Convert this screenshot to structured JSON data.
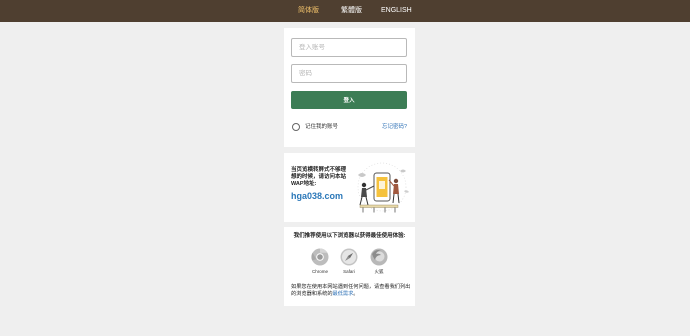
{
  "header": {
    "languages": [
      {
        "label": "简体版",
        "active": true
      },
      {
        "label": "繁體版",
        "active": false
      },
      {
        "label": "ENGLISH",
        "active": false
      }
    ]
  },
  "login": {
    "username_placeholder": "登入账号",
    "password_placeholder": "密码",
    "login_button": "登入",
    "remember_label": "记住我的账号",
    "forgot_link": "忘记密码?"
  },
  "app_promo": {
    "text": "当页览横转屏式不够理想的时候，请访问本站WAP地址:",
    "domain": "hga038.com",
    "illustration_icon": "phone-with-people-illustration"
  },
  "browsers": {
    "title": "我们推荐使用以下浏览器以获得最佳使用体验:",
    "items": [
      {
        "label": "Chrome",
        "icon": "chrome-icon"
      },
      {
        "label": "Safari",
        "icon": "safari-icon"
      },
      {
        "label": "火狐",
        "icon": "firefox-icon"
      }
    ],
    "note_before": "如果您在使用本网站遇到任何问题，请查看我们列出的浏览器和系统的",
    "note_link": "最低需求",
    "note_after": "。"
  },
  "colors": {
    "header_bg": "#4f3f30",
    "active_lang": "#f2c26b",
    "login_button": "#3c7d55",
    "link": "#2b6fb5"
  }
}
